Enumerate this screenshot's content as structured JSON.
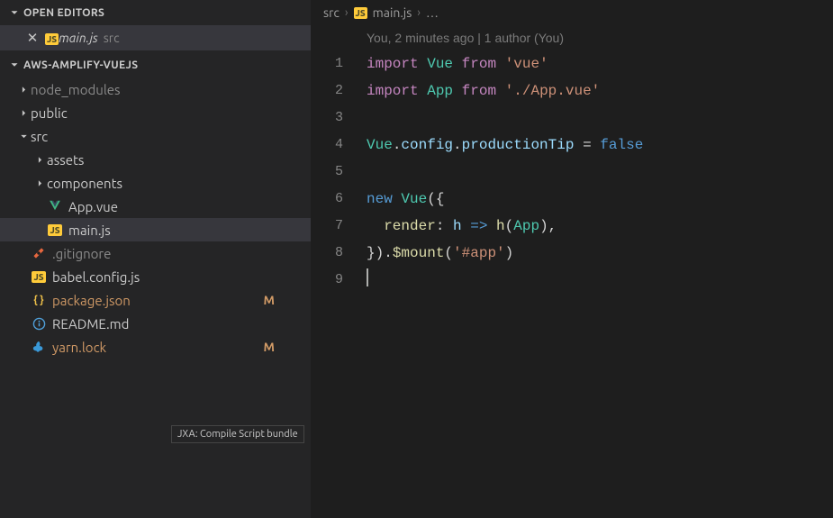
{
  "sidebar": {
    "openEditors": {
      "title": "OPEN EDITORS",
      "items": [
        {
          "icon": "JS",
          "name": "main.js",
          "dir": "src"
        }
      ]
    },
    "explorer": {
      "title": "AWS-AMPLIFY-VUEJS"
    },
    "tree": [
      {
        "depth": 0,
        "kind": "folder",
        "expanded": false,
        "name": "node_modules",
        "dimmed": true
      },
      {
        "depth": 0,
        "kind": "folder",
        "expanded": false,
        "name": "public"
      },
      {
        "depth": 0,
        "kind": "folder",
        "expanded": true,
        "name": "src"
      },
      {
        "depth": 1,
        "kind": "folder",
        "expanded": false,
        "name": "assets"
      },
      {
        "depth": 1,
        "kind": "folder",
        "expanded": false,
        "name": "components"
      },
      {
        "depth": 1,
        "kind": "file",
        "icon": "vue",
        "name": "App.vue"
      },
      {
        "depth": 1,
        "kind": "file",
        "icon": "js",
        "name": "main.js",
        "active": true
      },
      {
        "depth": 0,
        "kind": "file",
        "icon": "git",
        "name": ".gitignore",
        "dimmed": true
      },
      {
        "depth": 0,
        "kind": "file",
        "icon": "js",
        "name": "babel.config.js"
      },
      {
        "depth": 0,
        "kind": "file",
        "icon": "json",
        "name": "package.json",
        "badge": "M",
        "badgeColor": "#d19a66",
        "labelColor": "#d19a66"
      },
      {
        "depth": 0,
        "kind": "file",
        "icon": "info",
        "name": "README.md"
      },
      {
        "depth": 0,
        "kind": "file",
        "icon": "yarn",
        "name": "yarn.lock",
        "badge": "M",
        "badgeColor": "#d19a66",
        "labelColor": "#d19a66"
      }
    ],
    "tooltip": "JXA: Compile Script bundle"
  },
  "breadcrumbs": {
    "parts": [
      "src",
      "main.js"
    ],
    "trailing": "…",
    "icon": "JS"
  },
  "codelens": "You, 2 minutes ago | 1 author (You)",
  "code": {
    "lineNumbers": [
      1,
      2,
      3,
      4,
      5,
      6,
      7,
      8,
      9
    ],
    "lines": [
      [
        {
          "t": "import ",
          "c": "kw"
        },
        {
          "t": "Vue",
          "c": "type"
        },
        {
          "t": " ",
          "c": "plain"
        },
        {
          "t": "from ",
          "c": "kw"
        },
        {
          "t": "'vue'",
          "c": "str"
        }
      ],
      [
        {
          "t": "import ",
          "c": "kw"
        },
        {
          "t": "App",
          "c": "type"
        },
        {
          "t": " ",
          "c": "plain"
        },
        {
          "t": "from ",
          "c": "kw"
        },
        {
          "t": "'./App.vue'",
          "c": "str"
        }
      ],
      [],
      [
        {
          "t": "Vue",
          "c": "type"
        },
        {
          "t": ".",
          "c": "plain"
        },
        {
          "t": "config",
          "c": "prop"
        },
        {
          "t": ".",
          "c": "plain"
        },
        {
          "t": "productionTip",
          "c": "prop"
        },
        {
          "t": " = ",
          "c": "plain"
        },
        {
          "t": "false",
          "c": "const"
        }
      ],
      [],
      [
        {
          "t": "new ",
          "c": "new"
        },
        {
          "t": "Vue",
          "c": "type"
        },
        {
          "t": "({",
          "c": "plain"
        }
      ],
      [
        {
          "t": "  ",
          "c": "plain"
        },
        {
          "t": "render",
          "c": "fn"
        },
        {
          "t": ": ",
          "c": "plain"
        },
        {
          "t": "h",
          "c": "prop"
        },
        {
          "t": " ",
          "c": "plain"
        },
        {
          "t": "=>",
          "c": "const"
        },
        {
          "t": " ",
          "c": "plain"
        },
        {
          "t": "h",
          "c": "fn"
        },
        {
          "t": "(",
          "c": "plain"
        },
        {
          "t": "App",
          "c": "type"
        },
        {
          "t": "),",
          "c": "plain"
        }
      ],
      [
        {
          "t": "}).",
          "c": "plain"
        },
        {
          "t": "$mount",
          "c": "fn"
        },
        {
          "t": "(",
          "c": "plain"
        },
        {
          "t": "'#app'",
          "c": "str"
        },
        {
          "t": ")",
          "c": "plain"
        }
      ],
      []
    ]
  }
}
